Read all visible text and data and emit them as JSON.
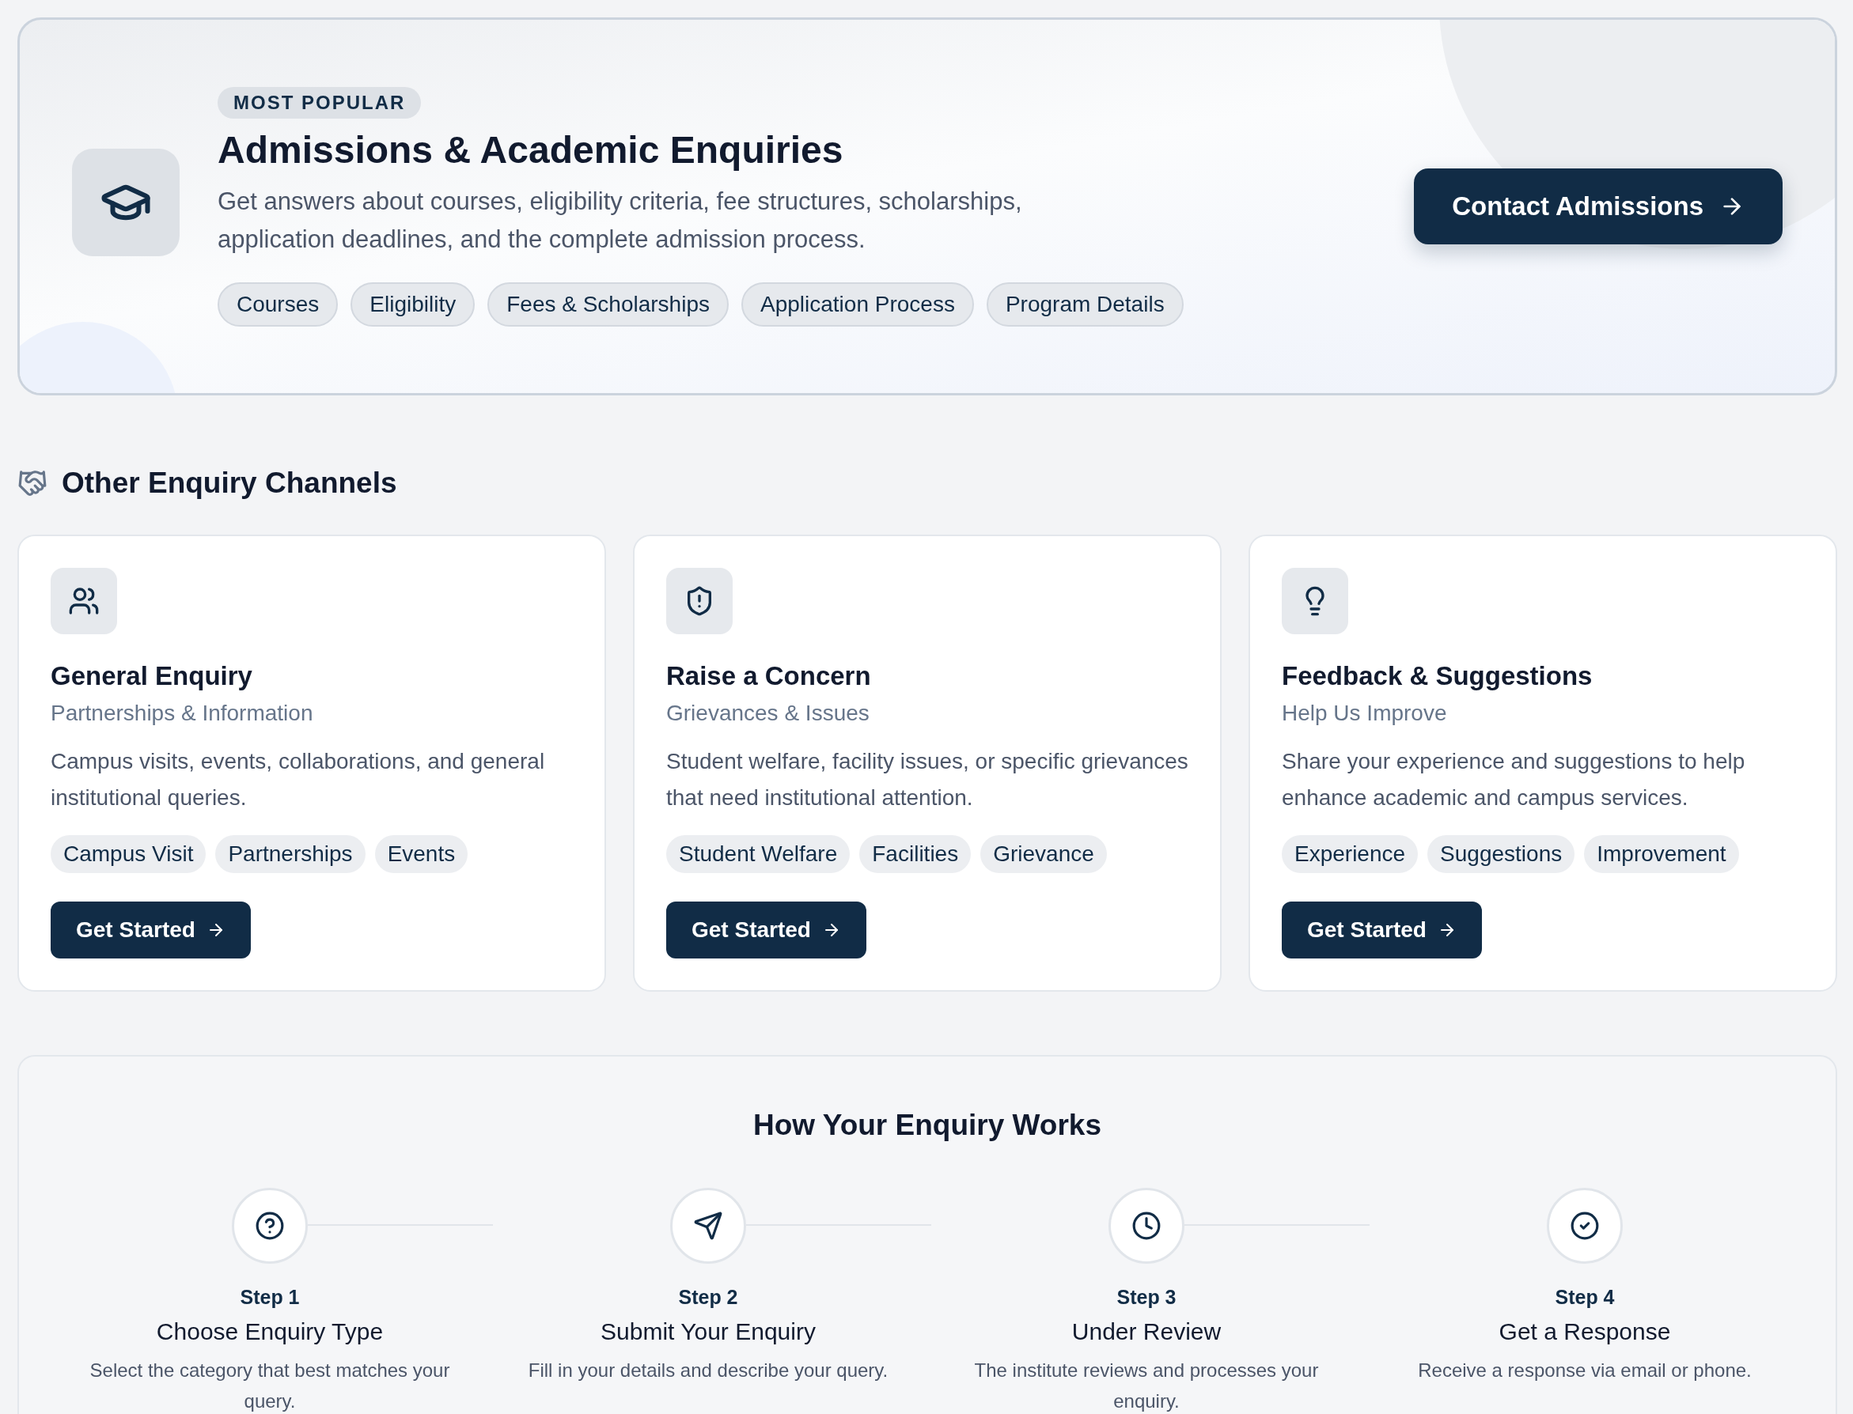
{
  "hero": {
    "badge": "MOST POPULAR",
    "title": "Admissions & Academic Enquiries",
    "description": "Get answers about courses, eligibility criteria, fee structures, scholarships, application deadlines, and the complete admission process.",
    "tags": [
      "Courses",
      "Eligibility",
      "Fees & Scholarships",
      "Application Process",
      "Program Details"
    ],
    "button": "Contact Admissions"
  },
  "channels_heading": "Other Enquiry Channels",
  "channels": [
    {
      "kind": "people",
      "title": "General Enquiry",
      "subtitle": "Partnerships & Information",
      "description": "Campus visits, events, collaborations, and general institutional queries.",
      "tags": [
        "Campus Visit",
        "Partnerships",
        "Events"
      ],
      "button": "Get Started"
    },
    {
      "kind": "shield",
      "title": "Raise a Concern",
      "subtitle": "Grievances & Issues",
      "description": "Student welfare, facility issues, or specific grievances that need institutional attention.",
      "tags": [
        "Student Welfare",
        "Facilities",
        "Grievance"
      ],
      "button": "Get Started"
    },
    {
      "kind": "bulb",
      "title": "Feedback & Suggestions",
      "subtitle": "Help Us Improve",
      "description": "Share your experience and suggestions to help enhance academic and campus services.",
      "tags": [
        "Experience",
        "Suggestions",
        "Improvement"
      ],
      "button": "Get Started"
    }
  ],
  "process": {
    "title": "How Your Enquiry Works",
    "steps": [
      {
        "kind": "question",
        "step": "Step 1",
        "title": "Choose Enquiry Type",
        "description": "Select the category that best matches your query."
      },
      {
        "kind": "send",
        "step": "Step 2",
        "title": "Submit Your Enquiry",
        "description": "Fill in your details and describe your query."
      },
      {
        "kind": "clock",
        "step": "Step 3",
        "title": "Under Review",
        "description": "The institute reviews and processes your enquiry."
      },
      {
        "kind": "check",
        "step": "Step 4",
        "title": "Get a Response",
        "description": "Receive a response via email or phone."
      }
    ]
  }
}
